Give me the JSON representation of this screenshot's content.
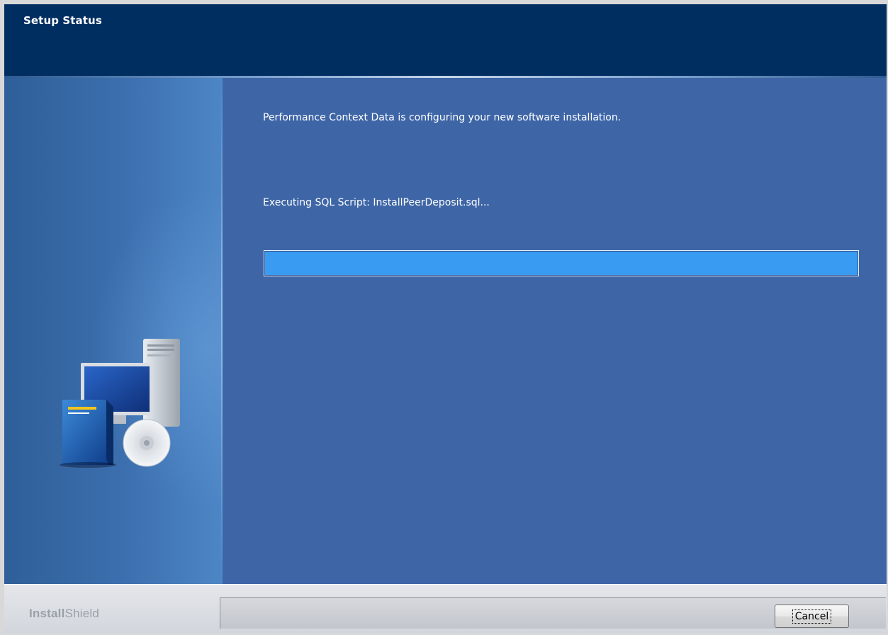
{
  "header": {
    "title": "Setup Status"
  },
  "main": {
    "message": "Performance Context Data is configuring your new software installation.",
    "status": "Executing SQL Script: InstallPeerDeposit.sql...",
    "progress_fraction": 1.0
  },
  "footer": {
    "brand_bold": "Install",
    "brand_light": "Shield",
    "cancel_label": "Cancel"
  },
  "colors": {
    "header_bg": "#002e61",
    "panel_bg": "#3e66a7",
    "progress_fill": "#3a9bf2"
  }
}
